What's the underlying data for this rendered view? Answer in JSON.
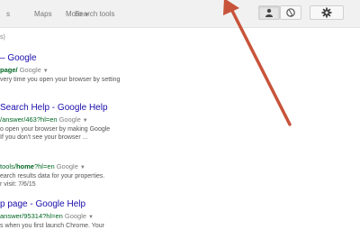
{
  "header": {
    "tabs": [
      {
        "label": "s"
      },
      {
        "label": "Maps"
      },
      {
        "label": "More"
      },
      {
        "label": "Search tools"
      }
    ],
    "buttons": [
      "person-icon",
      "globe-icon",
      "gear-icon"
    ]
  },
  "stats_text": "s)",
  "results": [
    {
      "title": "– Google",
      "url_bold": "page/",
      "url_rest": "",
      "source": "Google",
      "snippet": [
        "very time you open your browser by setting"
      ]
    },
    {
      "title": "Search Help - Google Help",
      "url_bold": "",
      "url_rest": "/answer/463?hl=en",
      "source": "Google",
      "snippet": [
        "o open your browser by making Google",
        "If you don't see your browser ..."
      ]
    },
    {
      "title": "",
      "url_bold": "home",
      "url_pre": "tools/",
      "url_rest": "?hl=en",
      "source": "Google",
      "snippet": [
        "earch results data for your properties.",
        "r visit: 7/6/15"
      ]
    },
    {
      "title": "p page - Google Help",
      "url_bold": "",
      "url_rest": "answer/95314?hl=en",
      "source": "Google",
      "snippet": [
        "s when you first launch Chrome. Your"
      ]
    }
  ],
  "colors": {
    "annotation_arrow": "#c8533a",
    "title_link": "#1a0dab",
    "url_green": "#006621"
  }
}
